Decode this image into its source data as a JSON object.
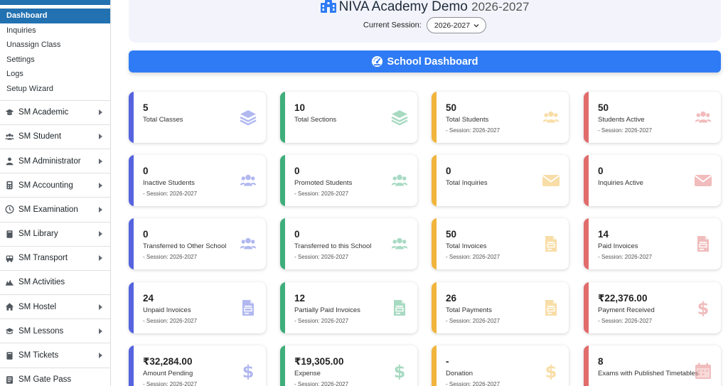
{
  "sidebar": {
    "sub_items": [
      {
        "label": "Dashboard",
        "active": true
      },
      {
        "label": "Inquiries",
        "active": false
      },
      {
        "label": "Unassign Class",
        "active": false
      },
      {
        "label": "Settings",
        "active": false
      },
      {
        "label": "Logs",
        "active": false
      },
      {
        "label": "Setup Wizard",
        "active": false
      }
    ],
    "menu": [
      {
        "label": "SM Academic",
        "icon": "graduation-cap-icon",
        "has_arrow": true
      },
      {
        "label": "SM Student",
        "icon": "users-icon",
        "has_arrow": true
      },
      {
        "label": "SM Administrator",
        "icon": "admin-user-icon",
        "has_arrow": true
      },
      {
        "label": "SM Accounting",
        "icon": "calculator-icon",
        "has_arrow": true
      },
      {
        "label": "SM Examination",
        "icon": "clock-icon",
        "has_arrow": true
      },
      {
        "label": "SM Library",
        "icon": "book-icon",
        "has_arrow": true
      },
      {
        "label": "SM Transport",
        "icon": "bus-icon",
        "has_arrow": true
      },
      {
        "label": "SM Activities",
        "icon": "activities-icon",
        "has_arrow": false
      },
      {
        "label": "SM Hostel",
        "icon": "home-icon",
        "has_arrow": true
      },
      {
        "label": "SM Lessons",
        "icon": "lessons-icon",
        "has_arrow": true
      },
      {
        "label": "SM Tickets",
        "icon": "ticket-book-icon",
        "has_arrow": true
      },
      {
        "label": "SM Gate Pass",
        "icon": "gate-pass-icon",
        "has_arrow": false
      }
    ]
  },
  "header": {
    "title": "NIVA Academy Demo",
    "year": "2026-2027",
    "session_label": "Current Session:",
    "session_value": "2026-2027"
  },
  "banner": {
    "title": "School Dashboard"
  },
  "colors": {
    "blue": "#5563de",
    "green": "#3fae7a",
    "yellow": "#f1b43c",
    "red": "#e06c6c",
    "accent": "#2f7bf5"
  },
  "cards": [
    {
      "value": "5",
      "label": "Total Classes",
      "session": "",
      "color": "blue",
      "icon": "layers-icon"
    },
    {
      "value": "10",
      "label": "Total Sections",
      "session": "",
      "color": "green",
      "icon": "layers-icon"
    },
    {
      "value": "50",
      "label": "Total Students",
      "session": "- Session: 2026-2027",
      "color": "yellow",
      "icon": "users-icon"
    },
    {
      "value": "50",
      "label": "Students Active",
      "session": "- Session: 2026-2027",
      "color": "red",
      "icon": "users-icon"
    },
    {
      "value": "0",
      "label": "Inactive Students",
      "session": "- Session: 2026-2027",
      "color": "blue",
      "icon": "users-icon"
    },
    {
      "value": "0",
      "label": "Promoted Students",
      "session": "- Session: 2026-2027",
      "color": "green",
      "icon": "users-icon"
    },
    {
      "value": "0",
      "label": "Total Inquiries",
      "session": "",
      "color": "yellow",
      "icon": "envelope-icon"
    },
    {
      "value": "0",
      "label": "Inquiries Active",
      "session": "",
      "color": "red",
      "icon": "envelope-icon"
    },
    {
      "value": "0",
      "label": "Transferred to Other School",
      "session": "- Session: 2026-2027",
      "color": "blue",
      "icon": "users-icon"
    },
    {
      "value": "0",
      "label": "Transferred to this School",
      "session": "- Session: 2026-2027",
      "color": "green",
      "icon": "users-icon"
    },
    {
      "value": "50",
      "label": "Total Invoices",
      "session": "- Session: 2026-2027",
      "color": "yellow",
      "icon": "invoice-icon"
    },
    {
      "value": "14",
      "label": "Paid Invoices",
      "session": "- Session: 2026-2027",
      "color": "red",
      "icon": "invoice-icon"
    },
    {
      "value": "24",
      "label": "Unpaid Invoices",
      "session": "- Session: 2026-2027",
      "color": "blue",
      "icon": "invoice-icon"
    },
    {
      "value": "12",
      "label": "Partially Paid Invoices",
      "session": "- Session: 2026-2027",
      "color": "green",
      "icon": "invoice-icon"
    },
    {
      "value": "26",
      "label": "Total Payments",
      "session": "- Session: 2026-2027",
      "color": "yellow",
      "icon": "invoice-icon"
    },
    {
      "value": "₹22,376.00",
      "label": "Payment Received",
      "session": "- Session: 2026-2027",
      "color": "red",
      "icon": "dollar-icon"
    },
    {
      "value": "₹32,284.00",
      "label": "Amount Pending",
      "session": "- Session: 2026-2027",
      "color": "blue",
      "icon": "dollar-icon"
    },
    {
      "value": "₹19,305.00",
      "label": "Expense",
      "session": "- Session: 2026-2027",
      "color": "green",
      "icon": "dollar-icon"
    },
    {
      "value": "-",
      "label": "Donation",
      "session": "- Session: 2026-2027",
      "color": "yellow",
      "icon": "dollar-icon"
    },
    {
      "value": "8",
      "label": "Exams with Published Timetables",
      "session": "",
      "color": "red",
      "icon": "calendar-icon"
    }
  ]
}
